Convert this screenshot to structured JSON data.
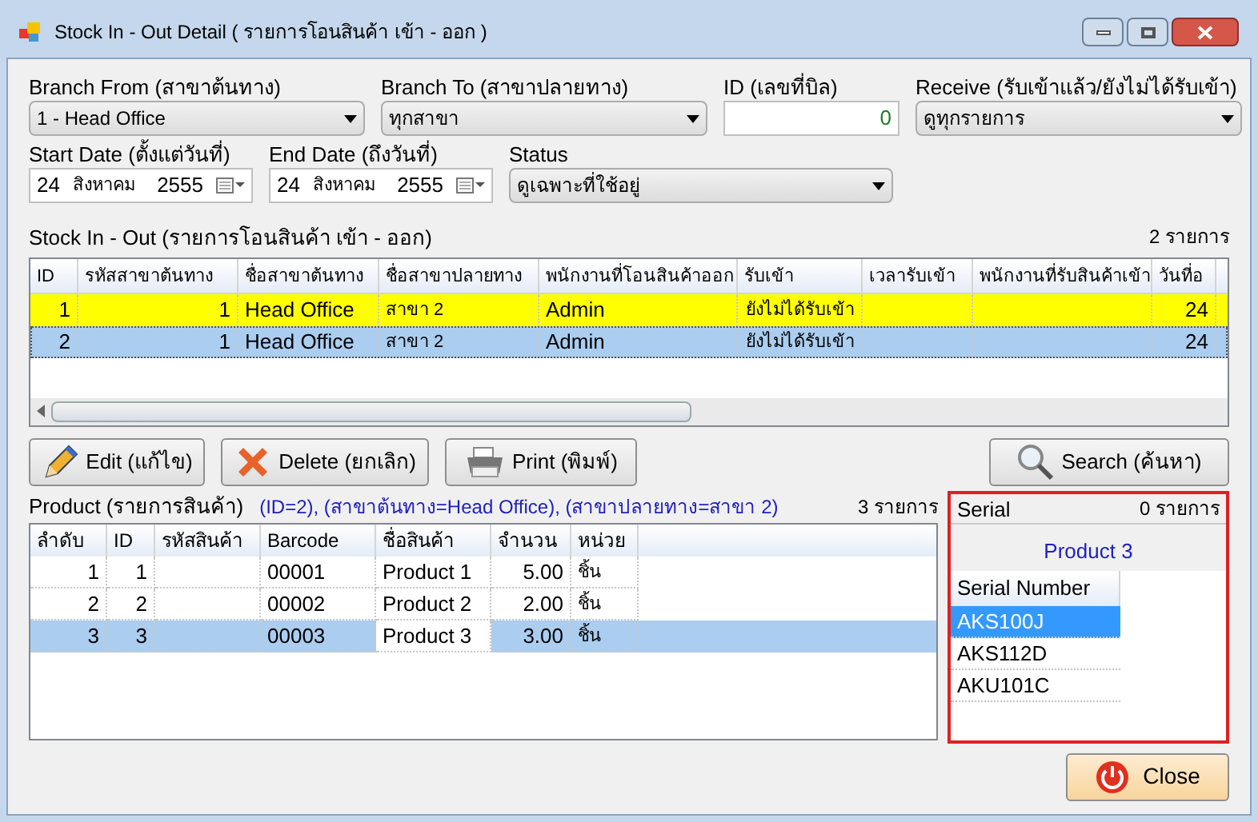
{
  "window": {
    "title": "Stock In - Out Detail ( รายการโอนสินค้า เข้า - ออก )"
  },
  "filters": {
    "branch_from": {
      "label": "Branch From (สาขาต้นทาง)",
      "value": "1 - Head Office"
    },
    "branch_to": {
      "label": "Branch To (สาขาปลายทาง)",
      "value": "ทุกสาขา"
    },
    "id": {
      "label": "ID (เลขที่บิล)",
      "value": "0"
    },
    "receive": {
      "label": "Receive (รับเข้าแล้ว/ยังไม่ได้รับเข้า)",
      "value": "ดูทุกรายการ"
    },
    "start_date": {
      "label": "Start Date (ตั้งแต่วันที่)",
      "day": "24",
      "month": "สิงหาคม",
      "year": "2555"
    },
    "end_date": {
      "label": "End Date (ถึงวันที่)",
      "day": "24",
      "month": "สิงหาคม",
      "year": "2555"
    },
    "status": {
      "label": "Status",
      "value": "ดูเฉพาะที่ใช้อยู่"
    }
  },
  "transfers": {
    "title": "Stock In - Out (รายการโอนสินค้า เข้า - ออก)",
    "count": "2 รายการ",
    "columns": [
      "ID",
      "รหัสสาขาต้นทาง",
      "ชื่อสาขาต้นทาง",
      "ชื่อสาขาปลายทาง",
      "พนักงานที่โอนสินค้าออก",
      "รับเข้า",
      "เวลารับเข้า",
      "พนักงานที่รับสินค้าเข้า",
      "วันที่อ"
    ],
    "rows": [
      {
        "cells": [
          "1",
          "1",
          "Head Office",
          "สาขา 2",
          "Admin",
          "ยังไม่ได้รับเข้า",
          "",
          "",
          "24"
        ],
        "highlighted": true,
        "selected": false
      },
      {
        "cells": [
          "2",
          "1",
          "Head Office",
          "สาขา 2",
          "Admin",
          "ยังไม่ได้รับเข้า",
          "",
          "",
          "24"
        ],
        "highlighted": false,
        "selected": true
      }
    ]
  },
  "actions": [
    {
      "kind": "edit",
      "label": "Edit (แก้ไข)"
    },
    {
      "kind": "delete",
      "label": "Delete (ยกเลิก)"
    },
    {
      "kind": "print",
      "label": "Print (พิมพ์)"
    }
  ],
  "search_button": {
    "label": "Search (ค้นหา)"
  },
  "products": {
    "title": "Product (รายการสินค้า)",
    "info": "(ID=2), (สาขาต้นทาง=Head Office), (สาขาปลายทาง=สาขา 2)",
    "count": "3 รายการ",
    "columns": [
      "ลำดับ",
      "ID",
      "รหัสสินค้า",
      "Barcode",
      "ชื่อสินค้า",
      "จำนวน",
      "หน่วย"
    ],
    "rows": [
      {
        "cells": [
          "1",
          "1",
          "",
          "00001",
          "Product 1",
          "5.00",
          "ชิ้น"
        ],
        "selected": false
      },
      {
        "cells": [
          "2",
          "2",
          "",
          "00002",
          "Product 2",
          "2.00",
          "ชิ้น"
        ],
        "selected": false
      },
      {
        "cells": [
          "3",
          "3",
          "",
          "00003",
          "Product 3",
          "3.00",
          "ชิ้น"
        ],
        "selected": true
      }
    ]
  },
  "serial": {
    "title": "Serial",
    "count": "0 รายการ",
    "product": "Product 3",
    "column": "Serial Number",
    "rows": [
      {
        "value": "AKS100J",
        "selected": true
      },
      {
        "value": "AKS112D",
        "selected": false
      },
      {
        "value": "AKU101C",
        "selected": false
      }
    ]
  },
  "close_button": {
    "label": "Close"
  }
}
